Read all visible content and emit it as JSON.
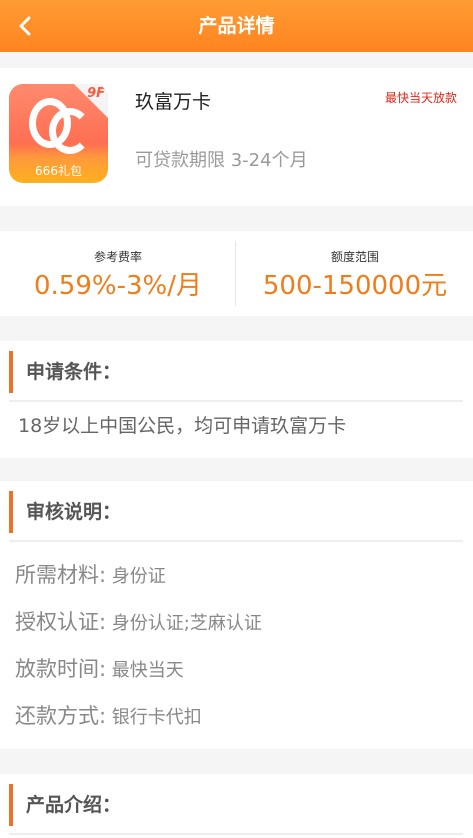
{
  "header": {
    "title": "产品详情",
    "back_icon": "chevron-left-icon"
  },
  "product": {
    "name": "玖富万卡",
    "tag": "最快当天放款",
    "term": "可贷款期限 3-24个月",
    "logo": {
      "badge": "9F",
      "label": "666礼包"
    }
  },
  "rates": {
    "rate_label": "参考费率",
    "rate_value": "0.59%-3%/月",
    "amount_label": "额度范围",
    "amount_value": "500-150000元"
  },
  "conditions": {
    "title": "申请条件：",
    "text": "18岁以上中国公民，均可申请玖富万卡"
  },
  "review": {
    "title": "审核说明：",
    "items": [
      {
        "key": "所需材料:",
        "value": " 身份证"
      },
      {
        "key": "授权认证:",
        "value": " 身份认证;芝麻认证"
      },
      {
        "key": "放款时间:",
        "value": " 最快当天"
      },
      {
        "key": "还款方式:",
        "value": " 银行卡代扣"
      }
    ]
  },
  "intro": {
    "title": "产品介绍："
  },
  "colors": {
    "header": "#ff8a26",
    "accent": "#f07d1a",
    "tag": "#e0281a",
    "bar": "#e8742a"
  }
}
